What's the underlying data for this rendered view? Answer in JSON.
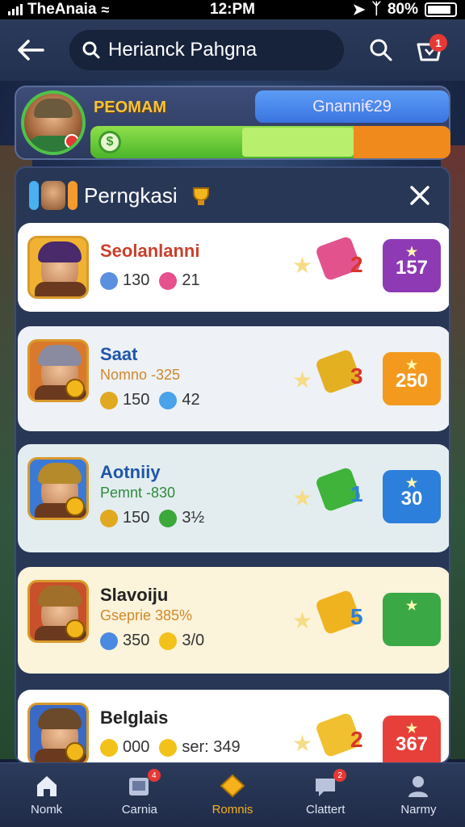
{
  "status_bar": {
    "carrier": "TheAnaia",
    "time": "12:PM",
    "battery": "80%"
  },
  "top_nav": {
    "search_value": "Herianck Pahgna",
    "cart_badge": "1"
  },
  "player": {
    "name": "PEOMAM",
    "score_label": "Gnanni€29",
    "progress": 0.73,
    "colors": {
      "progress_fill": "#4bb52a",
      "progress_track": "#f08a1c",
      "score_pill": "#3a74e0"
    }
  },
  "panel": {
    "title": "Perngkasi",
    "rows": [
      {
        "name": "Seolanlanni",
        "name_color": "#c8402b",
        "sub": "",
        "stat_a": "130",
        "stat_b": "21",
        "item_count": "2",
        "item_color": "#e2538d",
        "box_value": "157",
        "box_color": "#8e3ab5",
        "bg": "#ffffff"
      },
      {
        "name": "Saat",
        "name_color": "#1f56a8",
        "sub": "Nomno -325",
        "sub_color": "#d1882a",
        "stat_a": "150",
        "stat_b": "42",
        "item_count": "3",
        "item_color": "#e3b022",
        "box_value": "250",
        "box_color": "#f39a1e",
        "bg": "#eef1f5"
      },
      {
        "name": "Aotniiy",
        "name_color": "#1f56a8",
        "sub": "Pemnt -830",
        "sub_color": "#2e8a3a",
        "stat_a": "150",
        "stat_b": "3½",
        "item_count": "1",
        "item_color": "#3fb33a",
        "box_value": "30",
        "box_color": "#2d7fdc",
        "bg": "#e3edf0"
      },
      {
        "name": "Slavoiju",
        "name_color": "#222222",
        "sub": "Gseprie 385%",
        "sub_color": "#d1882a",
        "stat_a": "350",
        "stat_b": "3/0",
        "item_count": "5",
        "item_color": "#f0b320",
        "box_value": "",
        "box_color": "#3aa845",
        "bg": "#fbf3da"
      },
      {
        "name": "Belglais",
        "name_color": "#222222",
        "sub": "",
        "stat_a": "000",
        "stat_b": "ser: 349",
        "item_count": "2",
        "item_color": "#f0c030",
        "box_value": "367",
        "box_color": "#e7403a",
        "bg": "#ffffff"
      }
    ]
  },
  "bottom_nav": {
    "tabs": [
      {
        "label": "Nomk",
        "icon": "home-icon"
      },
      {
        "label": "Carnia",
        "icon": "cards-icon",
        "badge": "4"
      },
      {
        "label": "Romnis",
        "icon": "diamond-icon"
      },
      {
        "label": "Clattert",
        "icon": "chat-icon",
        "badge": "2"
      },
      {
        "label": "Narmy",
        "icon": "profile-icon"
      }
    ],
    "active_index": 2
  }
}
